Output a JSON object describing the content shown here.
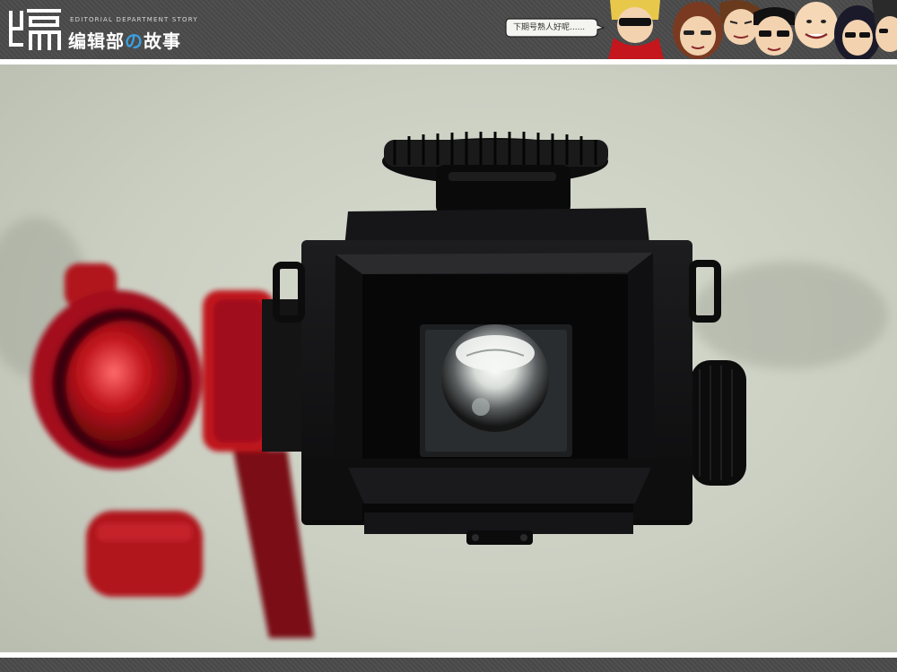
{
  "header": {
    "logo_icon": "bian-logo-icon",
    "subtitle": "EDITORIAL DEPARTMENT STORY",
    "title_main": "编辑部",
    "title_accent": "の",
    "title_end": "故事",
    "speech_bubble": "下期号熟人好呢......",
    "characters_icon": "cartoon-staff-faces-icon"
  },
  "photo": {
    "subject": "camera-viewfinder-photo",
    "colors": {
      "background": "#cfd3c6",
      "camera_body": "#111111",
      "accent_red": "#b0141c"
    }
  }
}
